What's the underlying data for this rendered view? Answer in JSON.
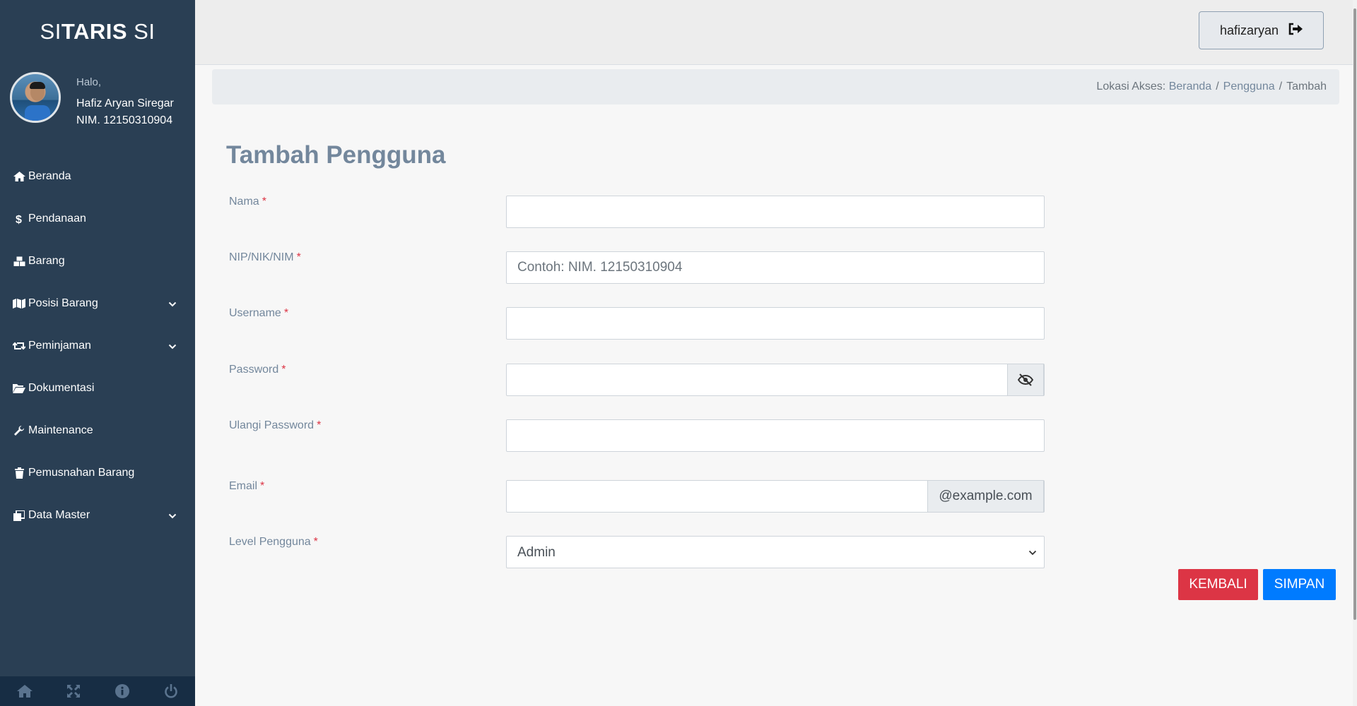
{
  "brand": {
    "part1": "SI",
    "part2": "TARIS",
    "part3": " SI"
  },
  "profile": {
    "greeting": "Halo,",
    "name": "Hafiz Aryan Siregar",
    "nim": "NIM. 12150310904"
  },
  "menu": [
    {
      "label": "Beranda",
      "icon": "home-icon",
      "has_submenu": false
    },
    {
      "label": "Pendanaan",
      "icon": "dollar-icon",
      "has_submenu": false
    },
    {
      "label": "Barang",
      "icon": "cubes-icon",
      "has_submenu": false
    },
    {
      "label": "Posisi Barang",
      "icon": "map-icon",
      "has_submenu": true
    },
    {
      "label": "Peminjaman",
      "icon": "retweet-icon",
      "has_submenu": true
    },
    {
      "label": "Dokumentasi",
      "icon": "folder-open-icon",
      "has_submenu": false
    },
    {
      "label": "Maintenance",
      "icon": "wrench-icon",
      "has_submenu": false
    },
    {
      "label": "Pemusnahan Barang",
      "icon": "trash-icon",
      "has_submenu": false
    },
    {
      "label": "Data Master",
      "icon": "clone-icon",
      "has_submenu": true
    }
  ],
  "footer_icons": [
    "home-icon",
    "expand-icon",
    "info-icon",
    "power-icon"
  ],
  "topbar": {
    "username": "hafizaryan",
    "logout_icon": "sign-out-icon"
  },
  "breadcrumb": {
    "prefix": "Lokasi Akses:",
    "items": [
      "Beranda",
      "Pengguna",
      "Tambah"
    ],
    "separator": "/"
  },
  "form": {
    "title": "Tambah Pengguna",
    "required_mark": "*",
    "fields": {
      "nama": {
        "label": "Nama",
        "value": "",
        "placeholder": ""
      },
      "nip": {
        "label": "NIP/NIK/NIM",
        "value": "",
        "placeholder": "Contoh: NIM. 12150310904"
      },
      "username": {
        "label": "Username",
        "value": "",
        "placeholder": ""
      },
      "password": {
        "label": "Password",
        "value": "",
        "placeholder": "",
        "toggle_icon": "eye-slash-icon"
      },
      "ulangi_password": {
        "label": "Ulangi Password",
        "value": "",
        "placeholder": ""
      },
      "email": {
        "label": "Email",
        "value": "",
        "placeholder": "",
        "suffix": "@example.com"
      },
      "level": {
        "label": "Level Pengguna",
        "selected": "Admin"
      }
    },
    "buttons": {
      "back": "KEMBALI",
      "save": "SIMPAN"
    }
  },
  "colors": {
    "sidebar": "#2a3f54",
    "sidebar_footer": "#172d44",
    "label": "#73879c",
    "required": "#dc3545",
    "danger": "#dc3545",
    "primary": "#007bff"
  }
}
